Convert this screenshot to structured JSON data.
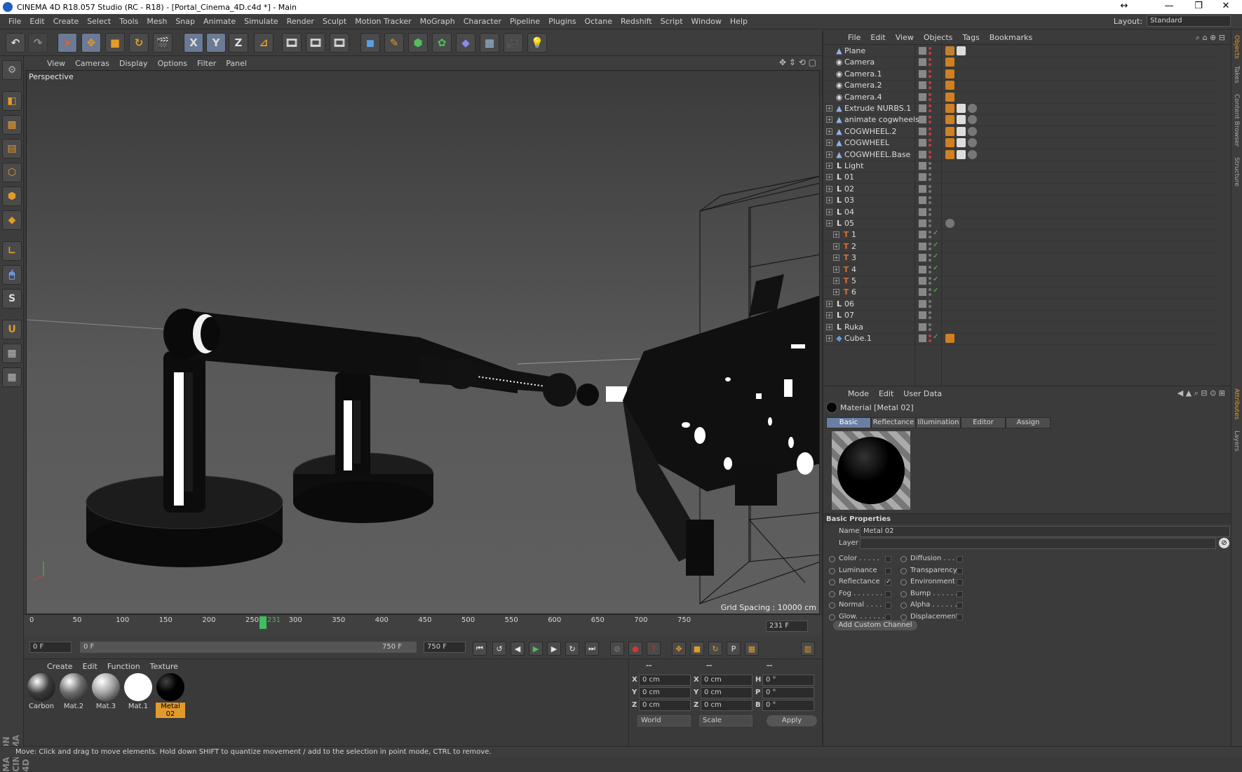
{
  "window": {
    "title": "CINEMA 4D R18.057 Studio (RC - R18) - [Portal_Cinema_4D.c4d *] - Main",
    "minimize": "—",
    "maximize": "❐",
    "close": "✕",
    "resize": "↔"
  },
  "menubar": {
    "items": [
      "File",
      "Edit",
      "Create",
      "Select",
      "Tools",
      "Mesh",
      "Snap",
      "Animate",
      "Simulate",
      "Render",
      "Sculpt",
      "Motion Tracker",
      "MoGraph",
      "Character",
      "Pipeline",
      "Plugins",
      "Octane",
      "Redshift",
      "Script",
      "Window",
      "Help"
    ],
    "layout_label": "Layout:",
    "layout_value": "Standard"
  },
  "toolbar": {
    "axis_x": "X",
    "axis_y": "Y",
    "axis_z": "Z"
  },
  "viewport": {
    "menu": [
      "View",
      "Cameras",
      "Display",
      "Options",
      "Filter",
      "Panel"
    ],
    "label": "Perspective",
    "grid_spacing": "Grid Spacing : 10000 cm"
  },
  "timeline": {
    "ticks": [
      "0",
      "50",
      "100",
      "150",
      "200",
      "250",
      "300",
      "350",
      "400",
      "450",
      "500",
      "550",
      "600",
      "650",
      "700",
      "750"
    ],
    "current_frame_label": "231",
    "current_frame_field": "231 F",
    "start_field": "0 F",
    "range_start": "0 F",
    "range_end": "750 F",
    "end_field": "750 F"
  },
  "materials": {
    "menu": [
      "Create",
      "Edit",
      "Function",
      "Texture"
    ],
    "items": [
      {
        "name": "Carbon",
        "color": "#3a3a3a"
      },
      {
        "name": "Mat.2",
        "color": "#6a6a6a"
      },
      {
        "name": "Mat.3",
        "color": "#a0a0a0"
      },
      {
        "name": "Mat.1",
        "color": "#ffffff"
      },
      {
        "name": "Metal 02",
        "color": "#050505"
      }
    ],
    "selected": "Metal 02"
  },
  "coordinates": {
    "header_left": "--",
    "header_mid": "--",
    "header_right": "--",
    "x_pos": "0 cm",
    "y_pos": "0 cm",
    "z_pos": "0 cm",
    "x_size": "0 cm",
    "y_size": "0 cm",
    "z_size": "0 cm",
    "h": "0 °",
    "p": "0 °",
    "b": "0 °",
    "space": "World",
    "mode": "Scale",
    "apply": "Apply"
  },
  "status": "Move: Click and drag to move elements. Hold down SHIFT to quantize movement / add to the selection in point mode, CTRL to remove.",
  "brand": "MAXON CINEMA 4D",
  "object_manager": {
    "menu": [
      "File",
      "Edit",
      "View",
      "Objects",
      "Tags",
      "Bookmarks"
    ],
    "objects": [
      {
        "name": "Plane",
        "icon": "plane-icon",
        "indent": 0,
        "expandable": false,
        "tags": [
          "#c08030",
          "#dddddd"
        ]
      },
      {
        "name": "Camera",
        "icon": "camera-icon",
        "indent": 0,
        "expandable": false,
        "tags": [
          "#d08020"
        ]
      },
      {
        "name": "Camera.1",
        "icon": "camera-icon",
        "indent": 0,
        "expandable": false,
        "tags": [
          "#d08020"
        ]
      },
      {
        "name": "Camera.2",
        "icon": "camera-icon",
        "indent": 0,
        "expandable": false,
        "tags": [
          "#d08020"
        ]
      },
      {
        "name": "Camera.4",
        "icon": "camera-icon",
        "indent": 0,
        "expandable": false,
        "tags": [
          "#d08020"
        ]
      },
      {
        "name": "Extrude NURBS.1",
        "icon": "nurbs-icon",
        "indent": 0,
        "expandable": true,
        "tags": [
          "#d08020",
          "#dddddd",
          "#777777"
        ]
      },
      {
        "name": "animate cogwheels",
        "icon": "nurbs-icon",
        "indent": 0,
        "expandable": true,
        "tags": [
          "#d08020",
          "#dddddd",
          "#777777"
        ]
      },
      {
        "name": "COGWHEEL.2",
        "icon": "nurbs-icon",
        "indent": 0,
        "expandable": true,
        "tags": [
          "#d08020",
          "#dddddd",
          "#777777"
        ]
      },
      {
        "name": "COGWHEEL",
        "icon": "nurbs-icon",
        "indent": 0,
        "expandable": true,
        "tags": [
          "#d08020",
          "#dddddd",
          "#777777"
        ]
      },
      {
        "name": "COGWHEEL.Base",
        "icon": "nurbs-icon",
        "indent": 0,
        "expandable": true,
        "tags": [
          "#d08020",
          "#dddddd",
          "#777777"
        ]
      },
      {
        "name": "Light",
        "icon": "null-icon",
        "indent": 0,
        "expandable": true,
        "tags": []
      },
      {
        "name": "01",
        "icon": "null-icon",
        "indent": 0,
        "expandable": true,
        "tags": []
      },
      {
        "name": "02",
        "icon": "null-icon",
        "indent": 0,
        "expandable": true,
        "tags": []
      },
      {
        "name": "03",
        "icon": "null-icon",
        "indent": 0,
        "expandable": true,
        "tags": []
      },
      {
        "name": "04",
        "icon": "null-icon",
        "indent": 0,
        "expandable": true,
        "tags": []
      },
      {
        "name": "05",
        "icon": "null-icon",
        "indent": 0,
        "expandable": true,
        "tags": [
          "#777777"
        ]
      },
      {
        "name": "1",
        "icon": "text-icon",
        "indent": 1,
        "expandable": true,
        "tags": []
      },
      {
        "name": "2",
        "icon": "text-icon",
        "indent": 1,
        "expandable": true,
        "tags": []
      },
      {
        "name": "3",
        "icon": "text-icon",
        "indent": 1,
        "expandable": true,
        "tags": []
      },
      {
        "name": "4",
        "icon": "text-icon",
        "indent": 1,
        "expandable": true,
        "tags": []
      },
      {
        "name": "5",
        "icon": "text-icon",
        "indent": 1,
        "expandable": true,
        "tags": []
      },
      {
        "name": "6",
        "icon": "text-icon",
        "indent": 1,
        "expandable": true,
        "tags": []
      },
      {
        "name": "06",
        "icon": "null-icon",
        "indent": 0,
        "expandable": true,
        "tags": []
      },
      {
        "name": "07",
        "icon": "null-icon",
        "indent": 0,
        "expandable": true,
        "tags": []
      },
      {
        "name": "Ruka",
        "icon": "null-icon",
        "indent": 0,
        "expandable": true,
        "tags": []
      },
      {
        "name": "Cube.1",
        "icon": "cube-icon",
        "indent": 0,
        "expandable": true,
        "tags": [
          "#d08020"
        ]
      }
    ]
  },
  "attribute_manager": {
    "menu": [
      "Mode",
      "Edit",
      "User Data"
    ],
    "object_title": "Material [Metal 02]",
    "tabs": [
      "Basic",
      "Reflectance",
      "Illumination",
      "Editor",
      "Assign"
    ],
    "active_tab": "Basic",
    "section": "Basic Properties",
    "name_label": "Name",
    "name_value": "Metal 02",
    "layer_label": "Layer",
    "channels_left": [
      {
        "label": "Color . . . . .",
        "checked": false
      },
      {
        "label": "Luminance",
        "checked": false
      },
      {
        "label": "Reflectance",
        "checked": true
      },
      {
        "label": "Fog . . . . . . .",
        "checked": false
      },
      {
        "label": "Normal . . . .",
        "checked": false
      },
      {
        "label": "Glow. . . . . . .",
        "checked": false
      }
    ],
    "channels_right": [
      {
        "label": "Diffusion . . .",
        "checked": false
      },
      {
        "label": "Transparency",
        "checked": false
      },
      {
        "label": "Environment",
        "checked": false
      },
      {
        "label": "Bump . . . . . .",
        "checked": false
      },
      {
        "label": "Alpha . . . . . .",
        "checked": false
      },
      {
        "label": "Displacement",
        "checked": false
      }
    ],
    "add_channel": "Add Custom Channel"
  },
  "right_strip": [
    "Objects",
    "Takes",
    "Content Browser",
    "Structure",
    "Attributes",
    "Layers"
  ],
  "colors": {
    "accent_blue": "#6a7fa4",
    "playhead_green": "#3fbf5f",
    "selected_material": "#e39a2c"
  }
}
